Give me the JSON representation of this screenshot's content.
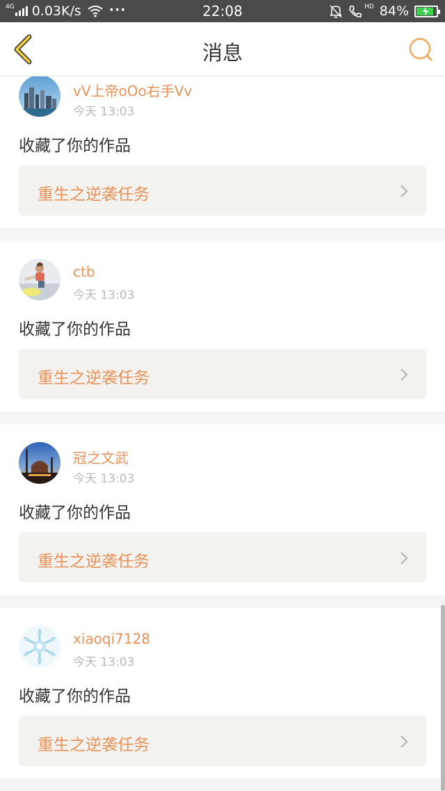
{
  "status_bar": {
    "network_type": "4G",
    "speed": "0.03K/s",
    "dots": "···",
    "time": "22:08",
    "hd": "HD",
    "battery_percent": "84%",
    "battery_level": 0.84,
    "battery_color": "#3cd34a"
  },
  "header": {
    "title": "消息",
    "back_icon": "chevron-left-icon",
    "search_icon": "search-icon",
    "accent_color": "#f5a65b"
  },
  "messages": [
    {
      "user": "vV上帝oOo右手Vv",
      "time": "今天 13:03",
      "action": "收藏了你的作品",
      "work": "重生之逆袭任务",
      "avatar": "city-skyline"
    },
    {
      "user": "ctb",
      "time": "今天 13:03",
      "action": "收藏了你的作品",
      "work": "重生之逆袭任务",
      "avatar": "child-photo"
    },
    {
      "user": "冠之文武",
      "time": "今天 13:03",
      "action": "收藏了你的作品",
      "work": "重生之逆袭任务",
      "avatar": "mosque-sunset"
    },
    {
      "user": "xiaoqi7128",
      "time": "今天 13:03",
      "action": "收藏了你的作品",
      "work": "重生之逆袭任务",
      "avatar": "snowflake-pattern"
    }
  ],
  "colors": {
    "username": "#e8925a",
    "work_title": "#e8925a",
    "card_link_bg": "#f3f2ee",
    "page_bg": "#f4f4f4"
  }
}
